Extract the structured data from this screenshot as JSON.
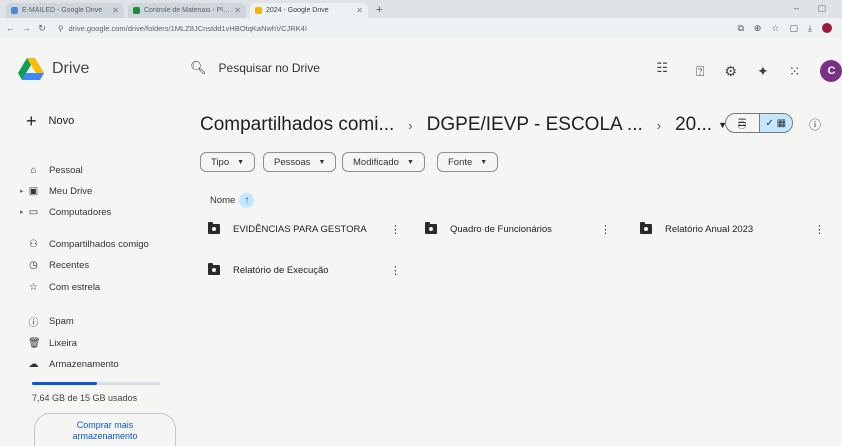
{
  "browser": {
    "tabs": [
      {
        "title": "E-MAILED - Google Drive",
        "color": "#4a8ad8"
      },
      {
        "title": "Controle de Materiais - Planil",
        "color": "#1e8e3e"
      },
      {
        "title": "2024 - Google Drive",
        "color": "#f4b400"
      }
    ],
    "url": "drive.google.com/drive/folders/1MLZ8JCnstdd1vHBOtqKaNwhVCJRK4I"
  },
  "app": {
    "name": "Drive"
  },
  "search": {
    "placeholder": "Pesquisar no Drive"
  },
  "header": {
    "avatar_letter": "C"
  },
  "sidebar": {
    "new_label": "Novo",
    "items": [
      {
        "label": "Pessoal",
        "icon": "home-icon"
      },
      {
        "label": "Meu Drive",
        "icon": "drive-icon"
      },
      {
        "label": "Computadores",
        "icon": "computer-icon"
      },
      {
        "label": "Compartilhados comigo",
        "icon": "people-icon"
      },
      {
        "label": "Recentes",
        "icon": "clock-icon"
      },
      {
        "label": "Com estrela",
        "icon": "star-icon"
      },
      {
        "label": "Spam",
        "icon": "spam-icon"
      },
      {
        "label": "Lixeira",
        "icon": "trash-icon"
      },
      {
        "label": "Armazenamento",
        "icon": "cloud-icon"
      }
    ],
    "storage": {
      "text": "7,64 GB de 15 GB usados",
      "used_fraction": 0.51
    },
    "buy_line1": "Comprar mais",
    "buy_line2": "armazenamento"
  },
  "breadcrumb": {
    "items": [
      "Compartilhados comi...",
      "DGPE/IEVP - ESCOLA ...",
      "20..."
    ]
  },
  "filters": {
    "chips": [
      "Tipo",
      "Pessoas",
      "Modificado",
      "Fonte"
    ]
  },
  "sort": {
    "label": "Nome"
  },
  "folders": [
    {
      "name": "EVIDÊNCIAS PARA GESTORA"
    },
    {
      "name": "Quadro de Funcionários"
    },
    {
      "name": "Relatório Anual 2023"
    },
    {
      "name": "Relatório de Execução"
    }
  ]
}
